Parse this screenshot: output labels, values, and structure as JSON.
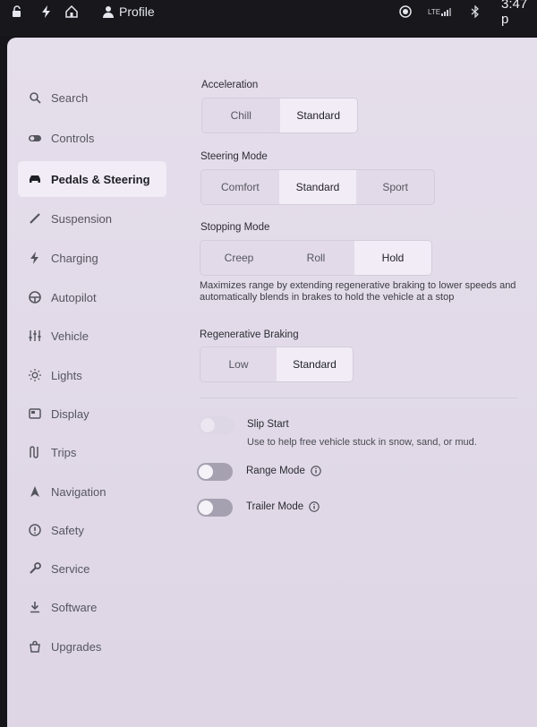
{
  "status_bar": {
    "profile_label": "Profile",
    "network": "LTE",
    "time": "3:47 p"
  },
  "sidebar": {
    "items": [
      {
        "label": "Search",
        "icon": "search-icon"
      },
      {
        "label": "Controls",
        "icon": "toggle-icon"
      },
      {
        "label": "Pedals & Steering",
        "icon": "car-icon",
        "active": true
      },
      {
        "label": "Suspension",
        "icon": "suspension-icon"
      },
      {
        "label": "Charging",
        "icon": "bolt-icon"
      },
      {
        "label": "Autopilot",
        "icon": "steering-wheel-icon"
      },
      {
        "label": "Vehicle",
        "icon": "sliders-icon"
      },
      {
        "label": "Lights",
        "icon": "sun-icon"
      },
      {
        "label": "Display",
        "icon": "display-icon"
      },
      {
        "label": "Trips",
        "icon": "route-icon"
      },
      {
        "label": "Navigation",
        "icon": "navigation-icon"
      },
      {
        "label": "Safety",
        "icon": "alert-circle-icon"
      },
      {
        "label": "Service",
        "icon": "wrench-icon"
      },
      {
        "label": "Software",
        "icon": "download-icon"
      },
      {
        "label": "Upgrades",
        "icon": "bag-icon"
      }
    ]
  },
  "acceleration": {
    "label": "Acceleration",
    "options": [
      "Chill",
      "Standard"
    ],
    "selected": "Standard"
  },
  "steering_mode": {
    "label": "Steering Mode",
    "options": [
      "Comfort",
      "Standard",
      "Sport"
    ],
    "selected": "Standard"
  },
  "stopping_mode": {
    "label": "Stopping Mode",
    "options": [
      "Creep",
      "Roll",
      "Hold"
    ],
    "selected": "Hold",
    "help": "Maximizes range by extending regenerative braking to lower speeds and automatically blends in brakes to hold the vehicle at a stop"
  },
  "regen_braking": {
    "label": "Regenerative Braking",
    "options": [
      "Low",
      "Standard"
    ],
    "selected": "Standard"
  },
  "slip_start": {
    "title": "Slip Start",
    "description": "Use to help free vehicle stuck in snow, sand, or mud.",
    "enabled": false
  },
  "range_mode": {
    "title": "Range Mode",
    "enabled": false
  },
  "trailer_mode": {
    "title": "Trailer Mode",
    "enabled": false
  }
}
